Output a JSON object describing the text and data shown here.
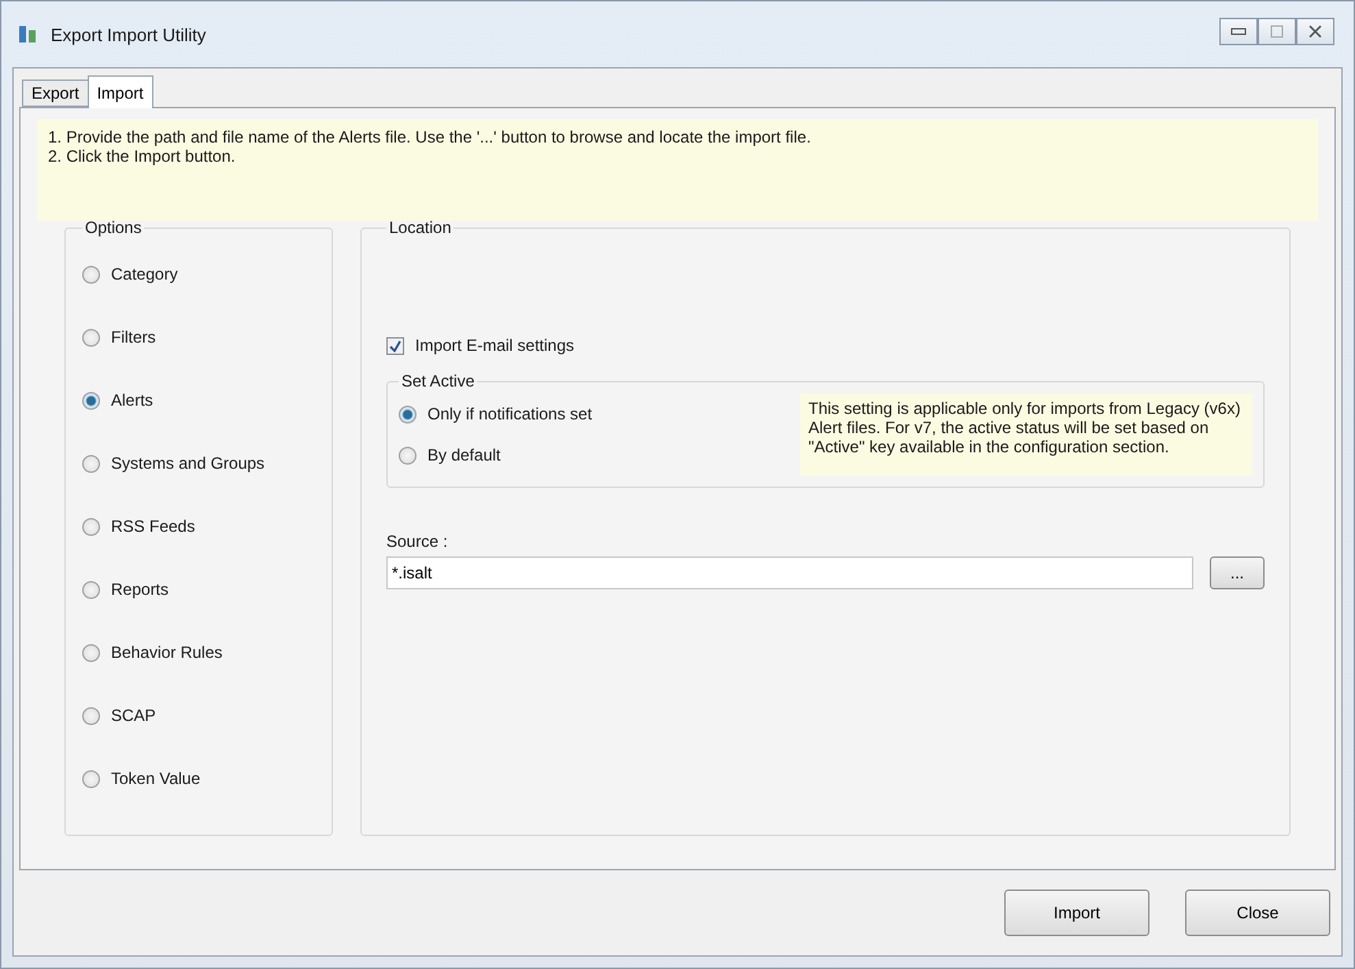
{
  "window": {
    "title": "Export Import Utility"
  },
  "tabs": [
    {
      "label": "Export",
      "selected": false
    },
    {
      "label": "Import",
      "selected": true
    }
  ],
  "instructions": [
    "1. Provide the path and file name of the Alerts file. Use the '...' button to browse and locate the import file.",
    "2. Click the Import button."
  ],
  "options": {
    "title": "Options",
    "items": [
      {
        "label": "Category",
        "selected": false
      },
      {
        "label": "Filters",
        "selected": false
      },
      {
        "label": "Alerts",
        "selected": true
      },
      {
        "label": "Systems and Groups",
        "selected": false
      },
      {
        "label": "RSS Feeds",
        "selected": false
      },
      {
        "label": "Reports",
        "selected": false
      },
      {
        "label": "Behavior Rules",
        "selected": false
      },
      {
        "label": "SCAP",
        "selected": false
      },
      {
        "label": "Token Value",
        "selected": false
      }
    ]
  },
  "location": {
    "title": "Location",
    "email_settings": {
      "label": "Import E-mail settings",
      "checked": true
    },
    "set_active": {
      "title": "Set Active",
      "items": [
        {
          "label": "Only if notifications set",
          "selected": true
        },
        {
          "label": "By default",
          "selected": false
        }
      ],
      "note": "This setting is applicable only for imports from Legacy (v6x) Alert files. For v7, the active status will be set based on \"Active\" key available in the configuration section."
    },
    "source": {
      "label": "Source :",
      "value": "*.isalt",
      "browse": "..."
    }
  },
  "buttons": [
    "Import",
    "Close"
  ]
}
